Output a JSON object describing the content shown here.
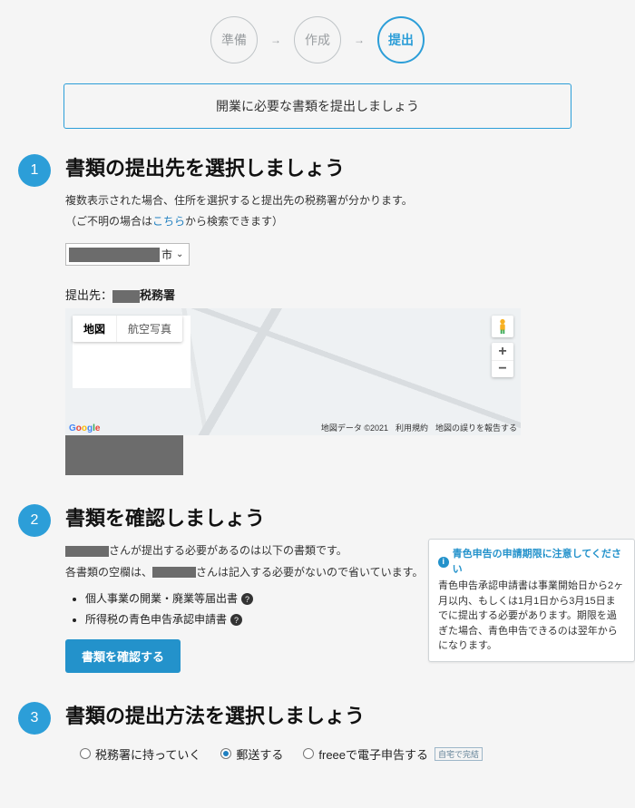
{
  "steps": {
    "s1": "準備",
    "s2": "作成",
    "s3": "提出"
  },
  "banner": "開業に必要な書類を提出しましょう",
  "section1": {
    "title": "書類の提出先を選択しましょう",
    "desc1": "複数表示された場合、住所を選択すると提出先の税務署が分かります。",
    "desc2_pre": "（ご不明の場合は",
    "desc2_link": "こちら",
    "desc2_post": "から検索できます）",
    "select_suffix": "市",
    "dest_label": "提出先：",
    "dest_suffix": "税務署",
    "map": {
      "tab_map": "地図",
      "tab_sat": "航空写真",
      "attr": "地図データ ©2021",
      "terms": "利用規約",
      "report": "地図の誤りを報告する"
    }
  },
  "section2": {
    "title": "書類を確認しましょう",
    "line1_mid": "さんが提出する必要があるのは以下の書類です。",
    "line2_pre": "各書類の空欄は、",
    "line2_post": "さんは記入する必要がないので省いています。",
    "doc1": "個人事業の開業・廃業等届出書",
    "doc2": "所得税の青色申告承認申請書",
    "button": "書類を確認する",
    "callout_title": "青色申告の申請期限に注意してください",
    "callout_body": "青色申告承認申請書は事業開始日から2ヶ月以内、もしくは1月1日から3月15日までに提出する必要があります。期限を過ぎた場合、青色申告できるのは翌年からになります。"
  },
  "section3": {
    "title": "書類の提出方法を選択しましょう",
    "opt1": "税務署に持っていく",
    "opt2": "郵送する",
    "opt3": "freeeで電子申告する",
    "opt3_badge": "自宅で完結"
  }
}
